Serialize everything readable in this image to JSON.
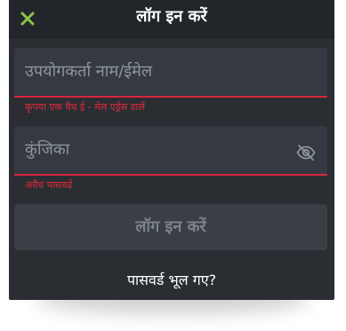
{
  "header": {
    "title": "लॉग इन करें",
    "close_icon": "close-icon"
  },
  "form": {
    "username": {
      "placeholder": "उपयोगकर्ता नाम/ईमेल",
      "value": "",
      "error": "कृपया एक वैध ई - मेल एड्रेस डालें"
    },
    "password": {
      "placeholder": "कुंजिका",
      "value": "",
      "error": "अवैध पासवर्ड",
      "toggle_icon": "eye-off-icon"
    },
    "submit_label": "लॉग इन करें",
    "forgot_label": "पासवर्ड भूल गए?"
  },
  "colors": {
    "background": "#2a2e33",
    "header": "#22262b",
    "field": "#353941",
    "error": "#d7263d",
    "close": "#8bc34a",
    "button": "#3a3e45",
    "button_text": "#7c828b",
    "text": "#ffffff"
  }
}
